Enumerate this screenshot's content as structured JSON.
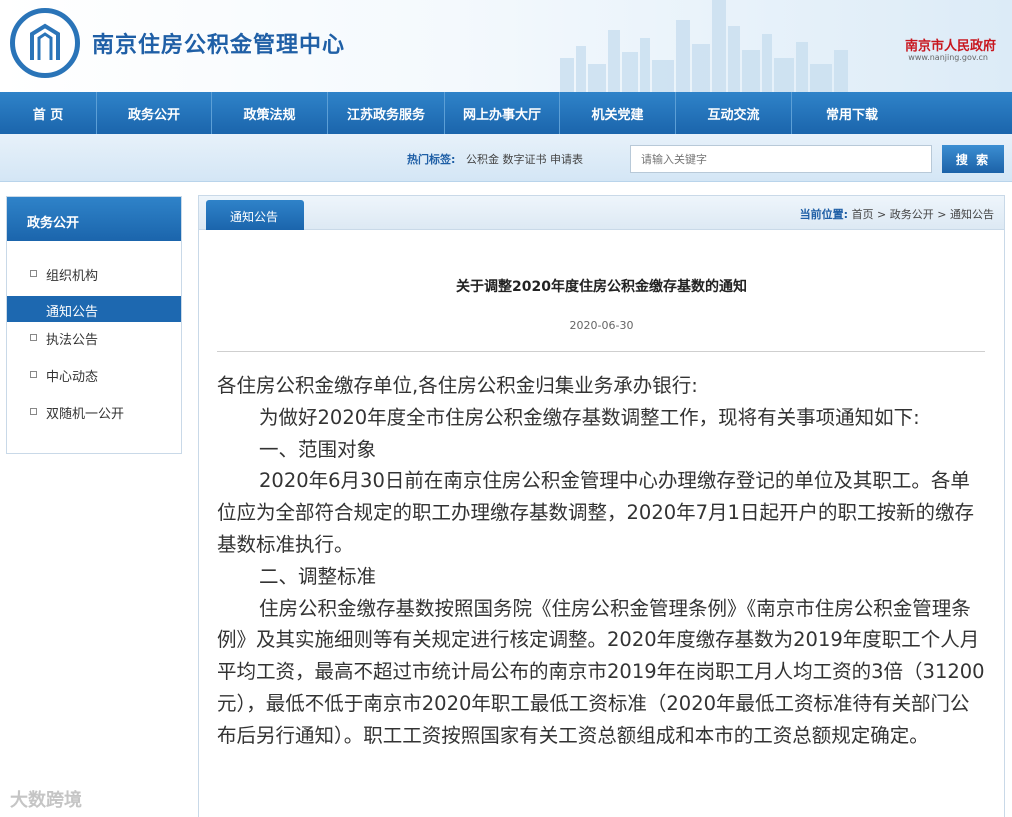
{
  "header": {
    "site_title": "南京住房公积金管理中心",
    "gov_name": "南京市人民政府",
    "gov_url": "www.nanjing.gov.cn"
  },
  "nav": [
    "首 页",
    "政务公开",
    "政策法规",
    "江苏政务服务",
    "网上办事大厅",
    "机关党建",
    "互动交流",
    "常用下载"
  ],
  "search": {
    "hot_label": "热门标签:",
    "hot_tags": "公积金 数字证书 申请表",
    "placeholder": "请输入关键字",
    "button": "搜 索"
  },
  "sidebar": {
    "title": "政务公开",
    "items": [
      {
        "label": "组织机构"
      },
      {
        "label": "通知公告"
      },
      {
        "label": "执法公告"
      },
      {
        "label": "中心动态"
      },
      {
        "label": "双随机一公开"
      }
    ]
  },
  "main": {
    "tab": "通知公告",
    "breadcrumb": {
      "label": "当前位置:",
      "home": "首页",
      "section": "政务公开",
      "current": "通知公告"
    },
    "title": "关于调整2020年度住房公积金缴存基数的通知",
    "date": "2020-06-30",
    "paragraphs": [
      "各住房公积金缴存单位,各住房公积金归集业务承办银行:",
      "为做好2020年度全市住房公积金缴存基数调整工作，现将有关事项通知如下:",
      "一、范围对象",
      "2020年6月30日前在南京住房公积金管理中心办理缴存登记的单位及其职工。各单位应为全部符合规定的职工办理缴存基数调整，2020年7月1日起开户的职工按新的缴存基数标准执行。",
      "二、调整标准",
      "住房公积金缴存基数按照国务院《住房公积金管理条例》《南京市住房公积金管理条例》及其实施细则等有关规定进行核定调整。2020年度缴存基数为2019年度职工个人月平均工资，最高不超过市统计局公布的南京市2019年在岗职工月人均工资的3倍（31200元），最低不低于南京市2020年职工最低工资标准（2020年最低工资标准待有关部门公布后另行通知）。职工工资按照国家有关工资总额组成和本市的工资总额规定确定。"
    ]
  },
  "watermark": "大数跨境"
}
